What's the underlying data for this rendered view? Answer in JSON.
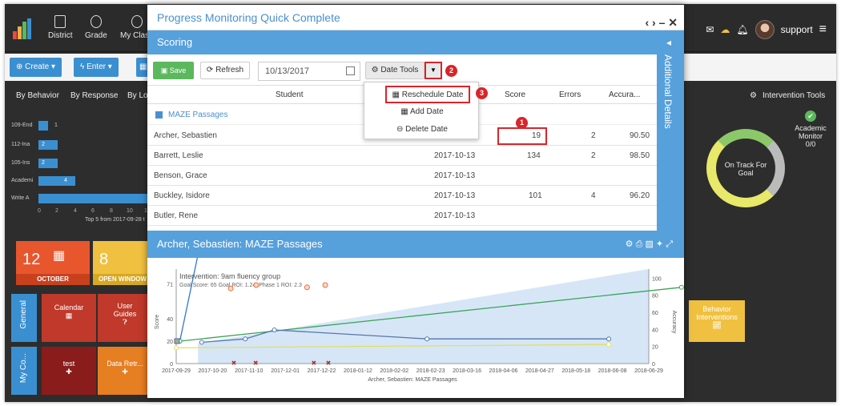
{
  "nav": {
    "items": [
      "District",
      "Grade",
      "My Class"
    ],
    "user": "support"
  },
  "toolbar": {
    "create": "Create",
    "enter": "Enter"
  },
  "tabs": [
    "By Behavior",
    "By Response",
    "By Loca"
  ],
  "intervention_tools": "Intervention Tools",
  "academic_monitor": {
    "label1": "Academic",
    "label2": "Monitor",
    "value": "0/0"
  },
  "on_track": {
    "line1": "On Track For",
    "line2": "Goal"
  },
  "left_chart": {
    "labels": [
      "109-End",
      "112-Ina",
      "105-Ins",
      "Academi",
      "Write A"
    ],
    "values": [
      "1",
      "2",
      "2",
      "4",
      ""
    ],
    "ticks": [
      "0",
      "2",
      "4",
      "6",
      "8",
      "10",
      "12"
    ],
    "caption": "Top 5 from 2017-09-28 t"
  },
  "tiles": {
    "day": "12",
    "month": "OCTOBER",
    "open_num": "8",
    "open": "OPEN WINDOW",
    "general": "General",
    "calendar": "Calendar",
    "user_guides": "User Guides",
    "my_co": "My Co...",
    "test": "test",
    "data_retr": "Data Retr...",
    "behavior_int": "Behavior Interventions"
  },
  "modal": {
    "title": "Progress Monitoring Quick Complete",
    "scoring": "Scoring",
    "save": "Save",
    "refresh": "Refresh",
    "date": "10/13/2017",
    "date_tools": "Date Tools",
    "headers": {
      "student": "Student",
      "score": "Score",
      "errors": "Errors",
      "accuracy": "Accura..."
    },
    "group": "MAZE Passages",
    "rows": [
      {
        "name": "Archer, Sebastien",
        "date": "2017-10-13",
        "score": "19",
        "errors": "2",
        "acc": "90.50"
      },
      {
        "name": "Barrett, Leslie",
        "date": "2017-10-13",
        "score": "134",
        "errors": "2",
        "acc": "98.50"
      },
      {
        "name": "Benson, Grace",
        "date": "2017-10-13",
        "score": "",
        "errors": "",
        "acc": ""
      },
      {
        "name": "Buckley, Isidore",
        "date": "2017-10-13",
        "score": "101",
        "errors": "4",
        "acc": "96.20"
      },
      {
        "name": "Butler, Rene",
        "date": "2017-10-13",
        "score": "",
        "errors": "",
        "acc": ""
      }
    ],
    "dropdown": [
      "Reschedule Date",
      "Add Date",
      "Delete Date"
    ],
    "badges": [
      "1",
      "2",
      "3"
    ],
    "side": "Additional Details",
    "detail_title": "Archer, Sebastien: MAZE Passages"
  },
  "chart_data": {
    "type": "line",
    "title": "Intervention: 9am fluency group",
    "subtitle": "Goal Score: 65  Goal ROI: 1.24, Phase 1 ROI: 2.3",
    "ylabel": "Score",
    "y2label": "Accuracy",
    "xlabel": "Archer, Sebastien: MAZE Passages",
    "xticks": [
      "2017-09-29",
      "2017-10-20",
      "2017-11-10",
      "2017-12-01",
      "2017-12-22",
      "2018-01-12",
      "2018-02-02",
      "2018-02-23",
      "2018-03-16",
      "2018-04-06",
      "2018-04-27",
      "2018-05-18",
      "2018-06-08",
      "2018-06-29"
    ],
    "yticks": [
      "0",
      "20",
      "40",
      "71"
    ],
    "y2ticks": [
      "0",
      "20",
      "40",
      "60",
      "80",
      "100"
    ],
    "ylim": [
      0,
      80
    ],
    "y2lim": [
      0,
      105
    ],
    "series": [
      {
        "color": "#2f78d2",
        "points": [
          [
            0.1,
            20
          ],
          [
            0.65,
            105
          ]
        ]
      },
      {
        "color": "#3aa655",
        "points": [
          [
            0.1,
            20
          ],
          [
            13.9,
            68
          ]
        ]
      },
      {
        "color": "#5577aa",
        "points": [
          [
            0.7,
            19
          ],
          [
            1.9,
            22
          ],
          [
            2.7,
            30
          ],
          [
            6.9,
            22
          ],
          [
            11.9,
            22
          ]
        ]
      },
      {
        "color": "#e0e060",
        "points": [
          [
            0,
            14
          ],
          [
            11.9,
            17
          ]
        ]
      }
    ],
    "outliers": [
      [
        1.5,
        67
      ],
      [
        2.2,
        70
      ],
      [
        3.6,
        68
      ],
      [
        4.1,
        70
      ]
    ]
  },
  "colors": {
    "blue": "#56a0dc",
    "red": "#d9252b",
    "green": "#5cb85c"
  }
}
